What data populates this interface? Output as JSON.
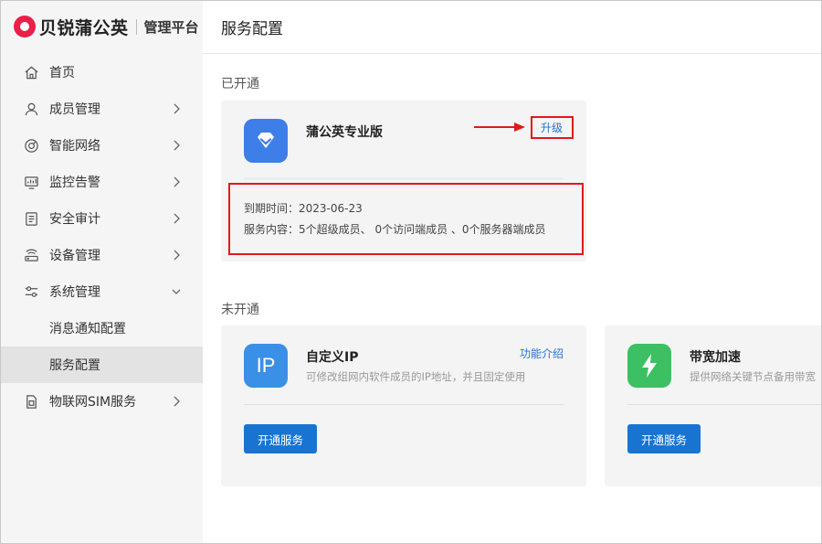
{
  "brand": {
    "name": "贝锐蒲公英",
    "subtitle": "管理平台"
  },
  "sidebar": {
    "items": [
      {
        "label": "首页",
        "icon": "home-icon"
      },
      {
        "label": "成员管理",
        "icon": "user-icon"
      },
      {
        "label": "智能网络",
        "icon": "network-icon"
      },
      {
        "label": "监控告警",
        "icon": "monitor-icon"
      },
      {
        "label": "安全审计",
        "icon": "audit-icon"
      },
      {
        "label": "设备管理",
        "icon": "router-icon"
      },
      {
        "label": "系统管理",
        "icon": "settings-sliders-icon"
      },
      {
        "label": "消息通知配置"
      },
      {
        "label": "服务配置"
      },
      {
        "label": "物联网SIM服务",
        "icon": "sim-icon"
      }
    ]
  },
  "header": {
    "title": "服务配置"
  },
  "enabled": {
    "section_title": "已开通",
    "card": {
      "name": "蒲公英专业版",
      "upgrade_label": "升级",
      "expiry_label": "到期时间：",
      "expiry_value": "2023-06-23",
      "content_label": "服务内容：",
      "content_value": "5个超级成员、 0个访问端成员 、0个服务器端成员"
    }
  },
  "disabled": {
    "section_title": "未开通",
    "cards": [
      {
        "name": "自定义IP",
        "icon_text": "IP",
        "desc": "可修改组网内软件成员的IP地址，并且固定使用",
        "feature_link": "功能介绍",
        "button": "开通服务"
      },
      {
        "name": "带宽加速",
        "desc": "提供网络关键节点备用带宽",
        "button": "开通服务"
      }
    ]
  },
  "colors": {
    "brand": "#e8204a",
    "primary": "#1874d0",
    "link": "#2673d0",
    "annotation": "#e11818",
    "pro_icon": "#3e7ee8",
    "ip_icon": "#3a8fe6",
    "bandwidth_icon": "#3cc063"
  }
}
